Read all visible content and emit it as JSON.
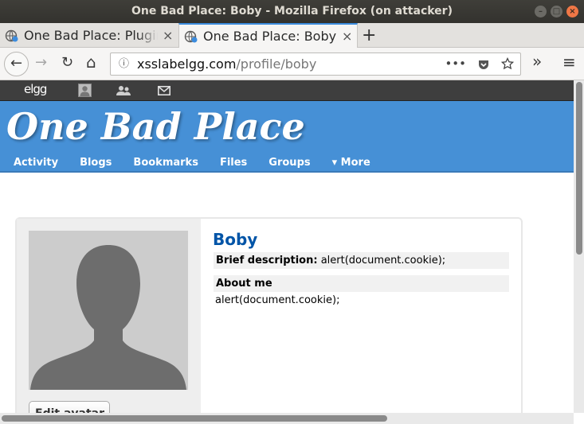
{
  "window": {
    "title": "One Bad Place: Boby - Mozilla Firefox (on attacker)",
    "minimize": "–",
    "maximize": "□",
    "close": "×"
  },
  "tabs": [
    {
      "label": "One Bad Place: Plugin",
      "active": false,
      "close": "×"
    },
    {
      "label": "One Bad Place: Boby",
      "active": true,
      "close": "×"
    }
  ],
  "newtab": "+",
  "nav": {
    "back": "←",
    "forward": "→",
    "reload": "↻",
    "home": "⌂",
    "info": "ⓘ",
    "url_host": "xsslabelgg.com",
    "url_path": "/profile/boby",
    "more": "•••",
    "overflow": "»",
    "menu": "≡"
  },
  "topbar": {
    "logo": "elgg"
  },
  "header": {
    "site_name": "One Bad Place",
    "menu": [
      "Activity",
      "Blogs",
      "Bookmarks",
      "Files",
      "Groups",
      "▾ More"
    ]
  },
  "profile": {
    "name": "Boby",
    "brief_label": "Brief description:",
    "brief_value": "alert(document.cookie);",
    "about_label": "About me",
    "about_value": "alert(document.cookie);",
    "edit_avatar": "Edit avatar"
  },
  "colors": {
    "header_bg": "#4690d6",
    "topbar_bg": "#3e3e3e",
    "name_color": "#0054a7",
    "tab_accent": "#3c8cde"
  }
}
